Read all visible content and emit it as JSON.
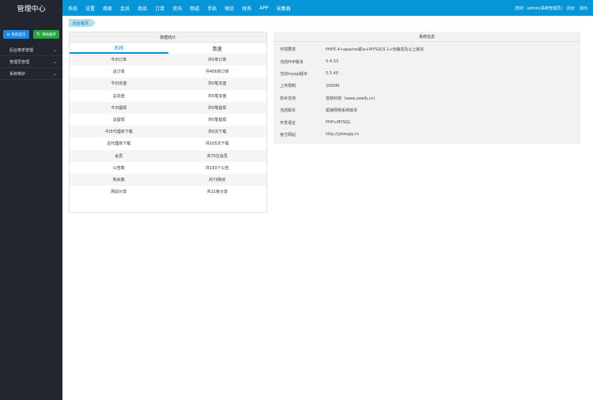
{
  "app_title": "管理中心",
  "topnav": [
    "系统",
    "设置",
    "商家",
    "会员",
    "商品",
    "订单",
    "资讯",
    "频道",
    "手机",
    "微信",
    "财务",
    "APP",
    "采集器"
  ],
  "topright": [
    "您好！admin(系统管理员)",
    "前台",
    "退出"
  ],
  "sidebar": {
    "quick1": "系统首页",
    "quick2": "清除缓存",
    "quick1_color": "#1e88e5",
    "quick2_color": "#29a342",
    "menu": [
      "后台菜单管理",
      "管理员管理",
      "系统维护"
    ]
  },
  "breadcrumb": "后台首页",
  "stats": {
    "title": "数据统计",
    "tab_name": "名称",
    "tab_count": "数量",
    "rows": [
      {
        "name": "今日订单",
        "value": "共0单订单"
      },
      {
        "name": "总订单",
        "value": "共406单订单"
      },
      {
        "name": "今日充值",
        "value": "共0笔充值"
      },
      {
        "name": "总充值",
        "value": "共0笔充值"
      },
      {
        "name": "今日提现",
        "value": "共0笔提现"
      },
      {
        "name": "总提现",
        "value": "共0笔提现"
      },
      {
        "name": "今日代理商下载",
        "value": "共0次下载"
      },
      {
        "name": "总代理商下载",
        "value": "共105次下载"
      },
      {
        "name": "会员",
        "value": "共75位会员"
      },
      {
        "name": "公告数",
        "value": "共193个公告"
      },
      {
        "name": "购买数",
        "value": "共73购买"
      },
      {
        "name": "网站分享",
        "value": "共21条分享"
      }
    ]
  },
  "sysinfo": {
    "title": "系统信息",
    "rows": [
      {
        "k": "环境要求",
        "v": "PHP5.4+apache或iis+MYSQL5.1+伪静态及以上版本"
      },
      {
        "k": "当前PHP版本",
        "v": "5.4.33"
      },
      {
        "k": "当前mysql版本",
        "v": "5.5.40"
      },
      {
        "k": "上传限制",
        "v": "1000M"
      },
      {
        "k": "技术支持",
        "v": "悦软科技（www.yewlb.cn）"
      },
      {
        "k": "当前版本",
        "v": "超速网络系统版本"
      },
      {
        "k": "开发语言",
        "v": "PHP+MYSQL"
      },
      {
        "k": "官方网站",
        "v": "http://ydwsgq.cn"
      }
    ]
  }
}
